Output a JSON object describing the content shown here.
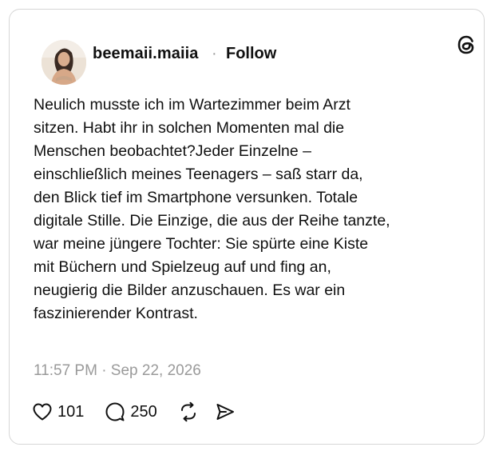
{
  "post": {
    "author": "beemaii.maiia",
    "separator": "·",
    "follow_label": "Follow",
    "body_lines": [
      "Neulich musste ich im Wartezimmer beim Arzt",
      "sitzen.  Habt ihr in solchen Momenten mal die",
      "Menschen beobachtet?Jeder Einzelne –",
      "einschließlich meines Teenagers – saß starr da,",
      "den Blick tief im Smartphone versunken. Totale",
      "digitale Stille. Die Einzige, die aus der Reihe tanzte,",
      "war meine jüngere Tochter: Sie spürte eine Kiste",
      "mit Büchern und Spielzeug auf und fing an,",
      "neugierig die Bilder anzuschauen. Es war ein",
      "faszinierender Kontrast."
    ],
    "timestamp": "11:57 PM · Sep 22, 2026"
  },
  "actions": {
    "like_icon": "heart-icon",
    "like_count": "101",
    "reply_icon": "comment-icon",
    "reply_count": "250",
    "repost_icon": "repost-icon",
    "share_icon": "share-icon"
  },
  "brand": {
    "logo_icon": "threads-logo-icon"
  },
  "colors": {
    "text": "#101010",
    "muted": "#9a9a9a",
    "border": "#d6d6d6"
  }
}
